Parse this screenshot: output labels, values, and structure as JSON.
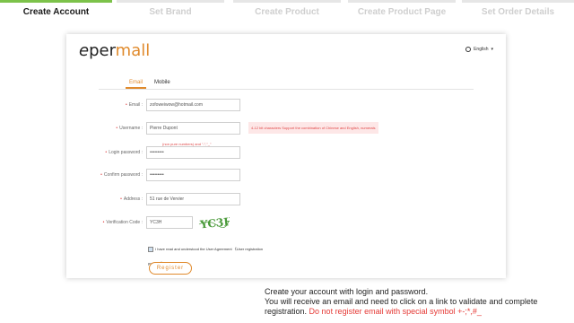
{
  "steps": [
    {
      "label": "Create Account"
    },
    {
      "label": "Set Brand"
    },
    {
      "label": "Create Product"
    },
    {
      "label": "Create Product Page"
    },
    {
      "label": "Set Order Details"
    }
  ],
  "header": {
    "logo_prefix": "e",
    "logo_mid": "per",
    "logo_suffix": "mall",
    "language": "English"
  },
  "tabs": {
    "email": "Email",
    "mobile": "Mobile"
  },
  "form": {
    "email": {
      "label": "Email :",
      "value": "zofoweiwow@hotmail.com"
    },
    "username": {
      "label": "Username :",
      "value": "Pierre Dupont",
      "error": "4-12 bit characters Support the combination of Chinese and English, numerals",
      "hint": "(non pure numbers) and \"-\",\"_\""
    },
    "login_password": {
      "label": "Login password :",
      "value": "•••••••••"
    },
    "confirm_password": {
      "label": "Confirm password :",
      "value": "•••••••••"
    },
    "address": {
      "label": "Address :",
      "value": "51 rue de Vervier"
    },
    "verification": {
      "label": "Verification Code :",
      "value": "YC3H",
      "captcha_text": "YC3H"
    },
    "agreement": "I have read and understood the User Agreement 《User registration protocol》",
    "register": "Register"
  },
  "instructions": {
    "line1": "Create your account with login and password.",
    "line2": "You will receive an email and need to click on a link to validate and complete registration.",
    "warning": "Do not register email with special symbol +-;*,#_"
  },
  "colors": {
    "accent": "#e08a2c",
    "active_step": "#7cc24a",
    "error": "#e04646"
  }
}
